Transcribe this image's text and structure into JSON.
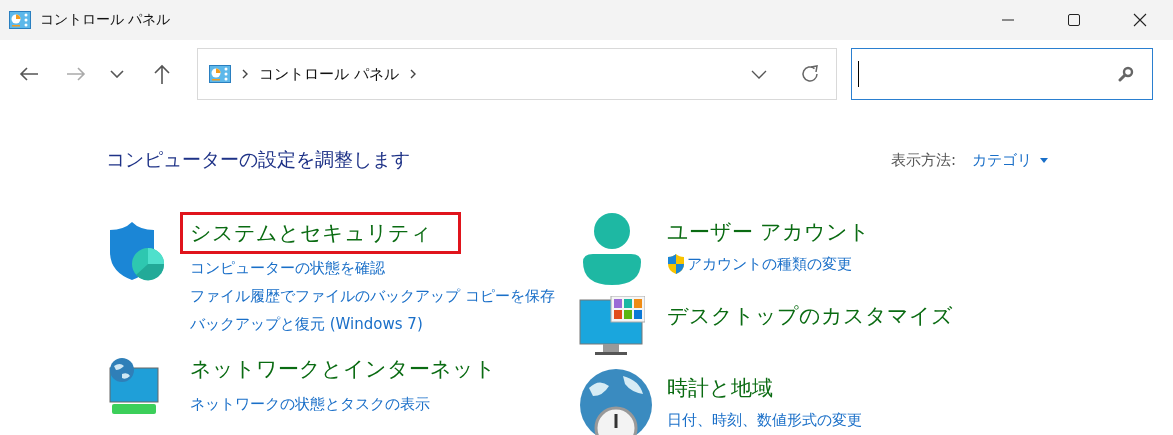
{
  "window": {
    "title": "コントロール パネル"
  },
  "address_bar": {
    "breadcrumb": [
      "コントロール パネル"
    ]
  },
  "search": {
    "focused": true
  },
  "heading": "コンピューターの設定を調整します",
  "view_by": {
    "label": "表示方法:",
    "value": "カテゴリ"
  },
  "columns": [
    [
      {
        "title": "システムとセキュリティ",
        "kind": "shield",
        "highlighted": true,
        "links": [
          {
            "text": "コンピューターの状態を確認",
            "shield": false
          },
          {
            "text": "ファイル履歴でファイルのバックアップ コピーを保存",
            "shield": false
          },
          {
            "text": "バックアップと復元 (Windows 7)",
            "shield": false
          }
        ]
      },
      {
        "title": "ネットワークとインターネット",
        "kind": "network",
        "highlighted": false,
        "links": [
          {
            "text": "ネットワークの状態とタスクの表示",
            "shield": false
          }
        ]
      }
    ],
    [
      {
        "title": "ユーザー アカウント",
        "kind": "user",
        "highlighted": false,
        "links": [
          {
            "text": "アカウントの種類の変更",
            "shield": true
          }
        ]
      },
      {
        "title": "デスクトップのカスタマイズ",
        "kind": "desktop",
        "highlighted": false
      },
      {
        "title": "時計と地域",
        "kind": "clock",
        "highlighted": false,
        "links": [
          {
            "text": "日付、時刻、数値形式の変更",
            "shield": false
          }
        ]
      }
    ]
  ]
}
